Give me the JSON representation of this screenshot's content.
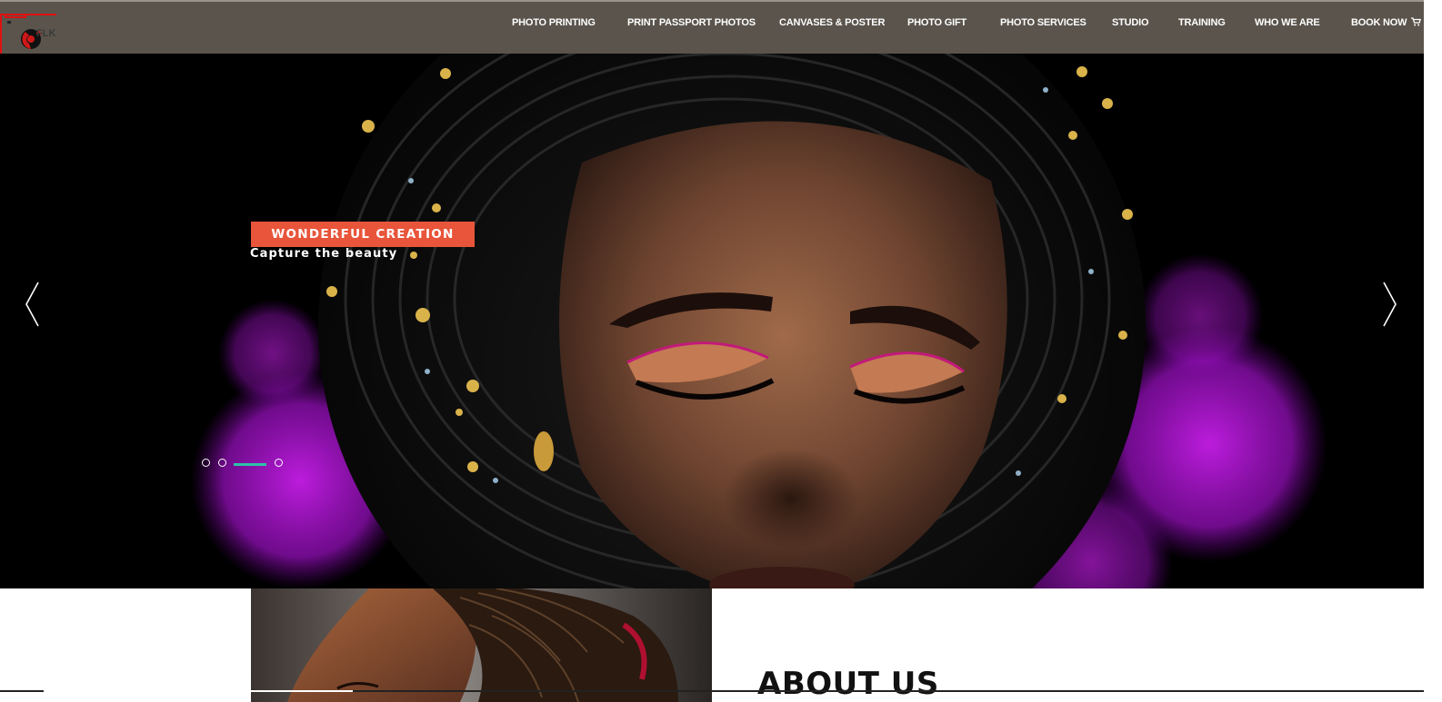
{
  "nav": {
    "logo_text": "FLK",
    "items": [
      {
        "label": "PHOTO PRINTING"
      },
      {
        "label": "PRINT PASSPORT PHOTOS"
      },
      {
        "label": "CANVASES & POSTER"
      },
      {
        "label": "PHOTO GIFT"
      },
      {
        "label": "PHOTO SERVICES"
      },
      {
        "label": "STUDIO"
      },
      {
        "label": "TRAINING"
      },
      {
        "label": "WHO WE ARE"
      },
      {
        "label": "BOOK NOW"
      }
    ],
    "cart_icon": "cart-icon"
  },
  "hero": {
    "badge": "WONDERFUL CREATION",
    "caption": "Capture the beauty",
    "prev_icon": "chevron-left-icon",
    "next_icon": "chevron-right-icon",
    "slides_total": 4,
    "active_slide": 3
  },
  "about": {
    "heading": "ABOUT US"
  },
  "colors": {
    "nav_bg": "#5a544c",
    "badge_bg": "#e8553a",
    "active_indicator": "#2dc2a8"
  }
}
